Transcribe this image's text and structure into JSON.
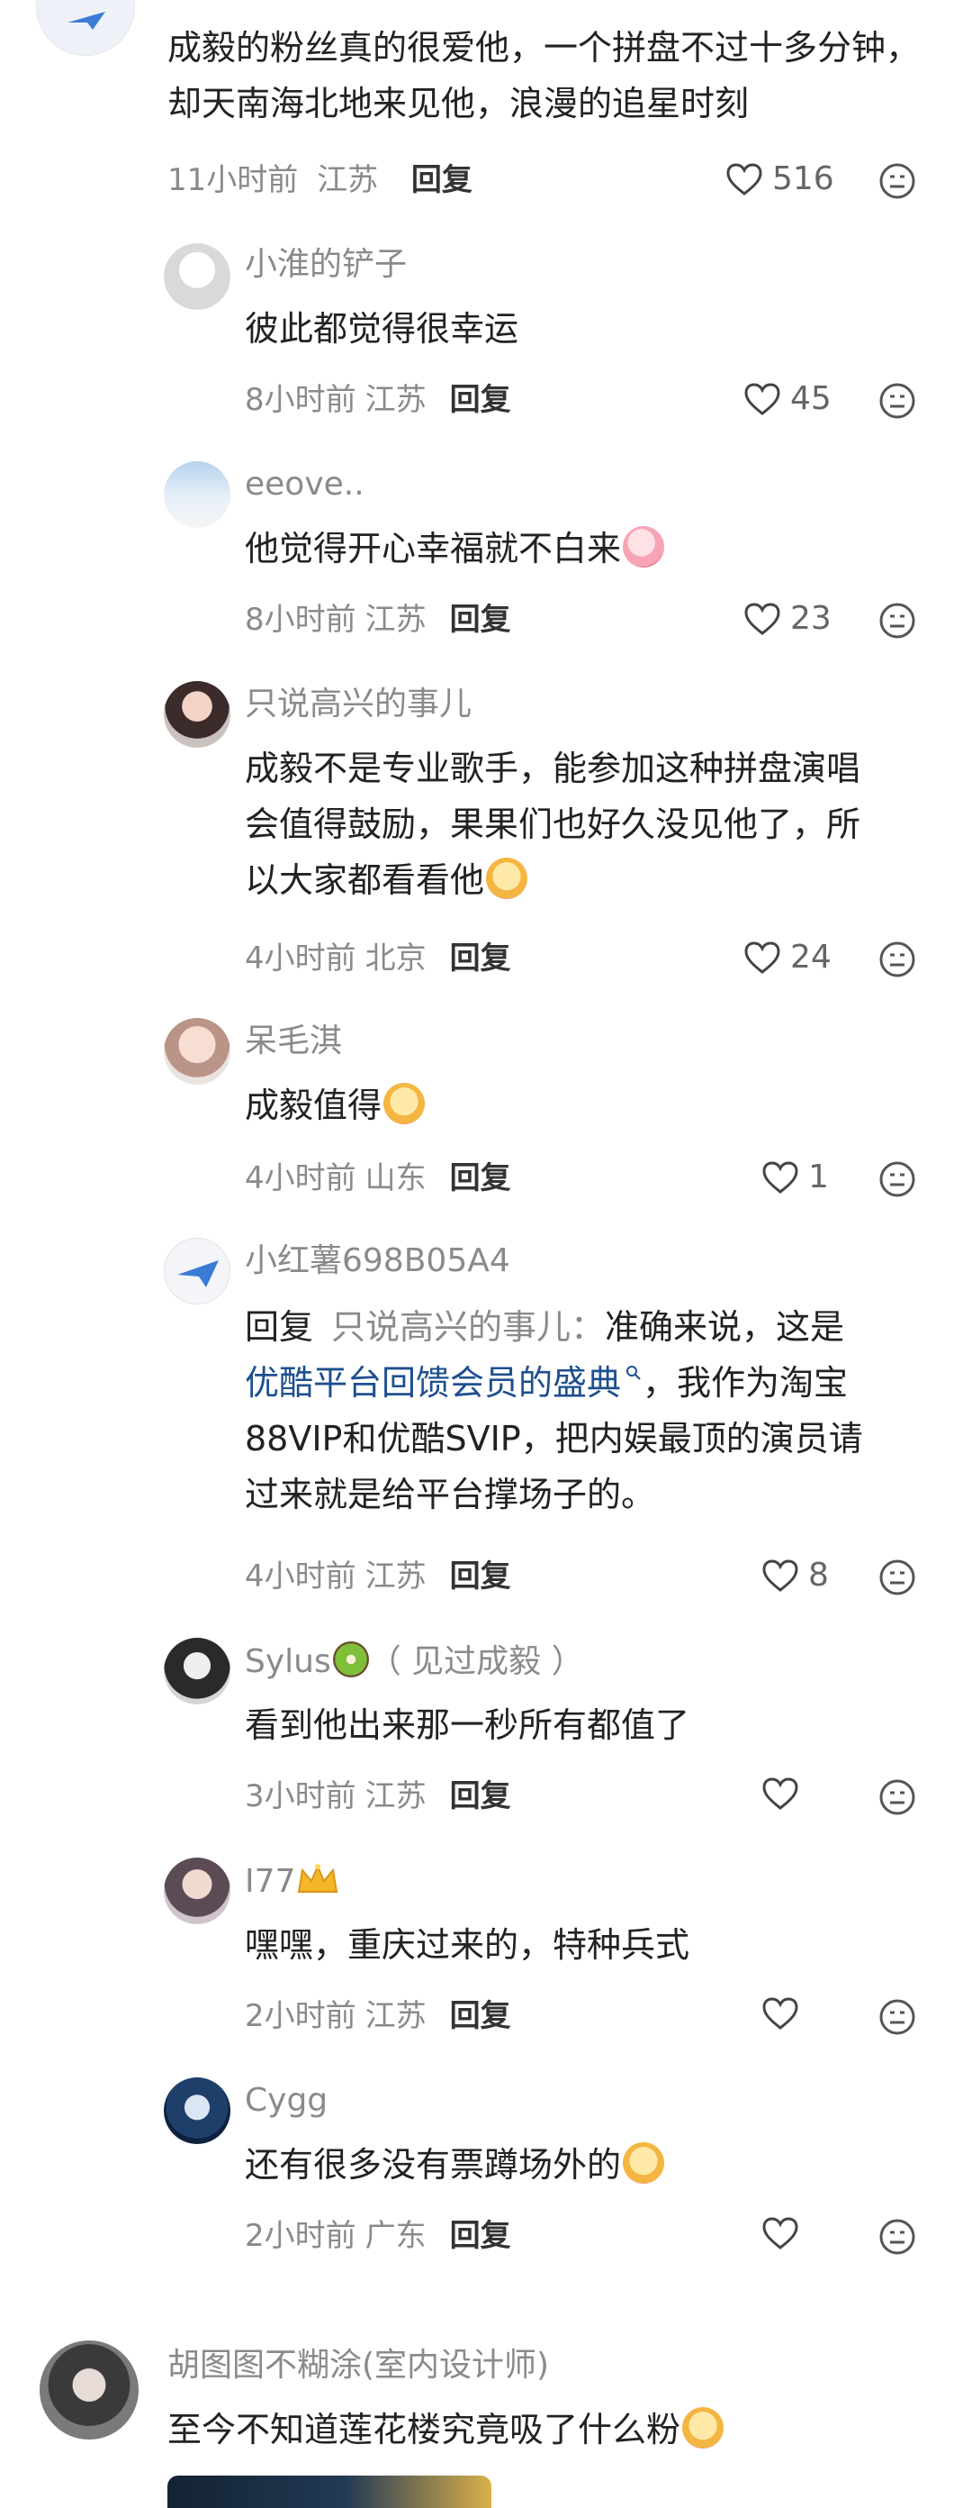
{
  "top_comment": {
    "text": "成毅的粉丝真的很爱他，一个拼盘不过十多分钟，却天南海北地来见他，浪漫的追星时刻",
    "time": "11小时前",
    "location": "江苏",
    "reply_label": "回复",
    "likes": "516"
  },
  "replies": [
    {
      "name": "小淮的铲子",
      "text": "彼此都觉得很幸运",
      "time": "8小时前",
      "location": "江苏",
      "reply_label": "回复",
      "likes": "45"
    },
    {
      "name": "eeove..",
      "text": "他觉得开心幸福就不白来",
      "time": "8小时前",
      "location": "江苏",
      "reply_label": "回复",
      "likes": "23"
    },
    {
      "name": "只说高兴的事儿",
      "text_lines": [
        "成毅不是专业歌手，能参加这种拼盘演唱",
        "会值得鼓励，果果们也好久没见他了，所",
        "以大家都看看他"
      ],
      "time": "4小时前",
      "location": "北京",
      "reply_label": "回复",
      "likes": "24"
    },
    {
      "name": "呆毛淇",
      "text": "成毅值得",
      "time": "4小时前",
      "location": "山东",
      "reply_label": "回复",
      "likes": "1"
    },
    {
      "name": "小红薯698B05A4",
      "reply_prefix": "回复",
      "reply_target": "只说高兴的事儿：",
      "text_first": "准确来说，这是",
      "link_text": "优酷平台回馈会员的盛典",
      "text_after_link": "，我作为淘宝",
      "text_lines_rest": [
        "88VIP和优酷SVIP，把内娱最顶的演员请",
        "过来就是给平台撑场子的。"
      ],
      "time": "4小时前",
      "location": "江苏",
      "reply_label": "回复",
      "likes": "8"
    },
    {
      "name": "Sylus",
      "name_suffix": "（ 见过成毅 ）",
      "text": "看到他出来那一秒所有都值了",
      "time": "3小时前",
      "location": "江苏",
      "reply_label": "回复",
      "likes": ""
    },
    {
      "name": "I77",
      "text": "嘿嘿，重庆过来的，特种兵式",
      "time": "2小时前",
      "location": "江苏",
      "reply_label": "回复",
      "likes": ""
    },
    {
      "name": "Cygg",
      "text": "还有很多没有票蹲场外的",
      "time": "2小时前",
      "location": "广东",
      "reply_label": "回复",
      "likes": ""
    }
  ],
  "next_comment": {
    "name": "胡图图不糊涂(室内设计师)",
    "text": "至今不知道莲花楼究竟吸了什么粉"
  },
  "icons": {
    "like": "heart-outline-icon",
    "more": "face-menu-icon",
    "search": "search-icon"
  },
  "colors": {
    "link": "#1e4f8f",
    "muted": "#8a8a8a"
  }
}
